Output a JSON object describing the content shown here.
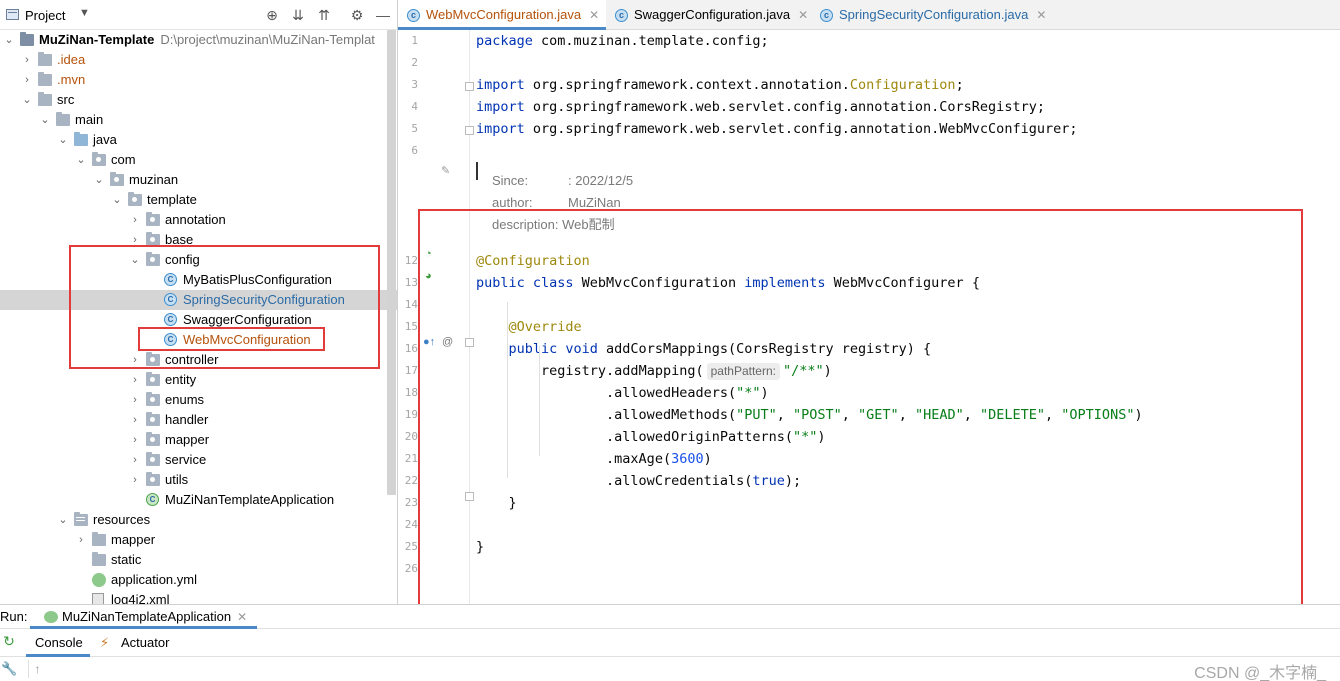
{
  "project_panel": {
    "title": "Project",
    "toolbar_icons": [
      "target-icon",
      "expand-all-icon",
      "collapse-all-icon",
      "gear-icon",
      "minimize-icon"
    ]
  },
  "tree": [
    {
      "label": "MuZiNan-Template",
      "note": "D:\\project\\muzinan\\MuZiNan-Templat",
      "depth": 0,
      "expanded": true,
      "icon": "module-folder"
    },
    {
      "label": ".idea",
      "depth": 1,
      "expanded": false,
      "icon": "folder"
    },
    {
      "label": ".mvn",
      "depth": 1,
      "expanded": false,
      "icon": "folder"
    },
    {
      "label": "src",
      "depth": 1,
      "expanded": true,
      "icon": "folder"
    },
    {
      "label": "main",
      "depth": 2,
      "expanded": true,
      "icon": "folder"
    },
    {
      "label": "java",
      "depth": 3,
      "expanded": true,
      "icon": "source-folder"
    },
    {
      "label": "com",
      "depth": 4,
      "expanded": true,
      "icon": "package"
    },
    {
      "label": "muzinan",
      "depth": 5,
      "expanded": true,
      "icon": "package"
    },
    {
      "label": "template",
      "depth": 6,
      "expanded": true,
      "icon": "package"
    },
    {
      "label": "annotation",
      "depth": 7,
      "expanded": false,
      "icon": "package"
    },
    {
      "label": "base",
      "depth": 7,
      "expanded": false,
      "icon": "package"
    },
    {
      "label": "config",
      "depth": 7,
      "expanded": true,
      "icon": "package"
    },
    {
      "label": "MyBatisPlusConfiguration",
      "depth": 8,
      "icon": "class"
    },
    {
      "label": "SpringSecurityConfiguration",
      "depth": 8,
      "icon": "class",
      "selected": true
    },
    {
      "label": "SwaggerConfiguration",
      "depth": 8,
      "icon": "class"
    },
    {
      "label": "WebMvcConfiguration",
      "depth": 8,
      "icon": "class",
      "modified": true
    },
    {
      "label": "controller",
      "depth": 7,
      "expanded": false,
      "icon": "package"
    },
    {
      "label": "entity",
      "depth": 7,
      "expanded": false,
      "icon": "package"
    },
    {
      "label": "enums",
      "depth": 7,
      "expanded": false,
      "icon": "package"
    },
    {
      "label": "handler",
      "depth": 7,
      "expanded": false,
      "icon": "package"
    },
    {
      "label": "mapper",
      "depth": 7,
      "expanded": false,
      "icon": "package"
    },
    {
      "label": "service",
      "depth": 7,
      "expanded": false,
      "icon": "package"
    },
    {
      "label": "utils",
      "depth": 7,
      "expanded": false,
      "icon": "package"
    },
    {
      "label": "MuZiNanTemplateApplication",
      "depth": 7,
      "icon": "app-class"
    },
    {
      "label": "resources",
      "depth": 3,
      "expanded": true,
      "icon": "resources-folder"
    },
    {
      "label": "mapper",
      "depth": 4,
      "expanded": false,
      "icon": "folder"
    },
    {
      "label": "static",
      "depth": 4,
      "icon": "folder"
    },
    {
      "label": "application.yml",
      "depth": 4,
      "icon": "yml-file"
    },
    {
      "label": "log4j2.xml",
      "depth": 4,
      "icon": "xml-file"
    }
  ],
  "editor": {
    "tabs": [
      {
        "label": "WebMvcConfiguration.java",
        "active": true,
        "color": "#b5520b"
      },
      {
        "label": "SwaggerConfiguration.java",
        "active": false,
        "color": "#000000"
      },
      {
        "label": "SpringSecurityConfiguration.java",
        "active": false,
        "color": "#2a6ba6"
      }
    ],
    "line_numbers": [
      "1",
      "2",
      "3",
      "4",
      "5",
      "6",
      "12",
      "13",
      "14",
      "15",
      "16",
      "17",
      "18",
      "19",
      "20",
      "21",
      "22",
      "23",
      "24",
      "25",
      "26"
    ],
    "code": {
      "l1": [
        "package",
        " com.muzinan.template.config;"
      ],
      "l3": [
        "import",
        " org.springframework.context.annotation.",
        "Configuration",
        ";"
      ],
      "l4": [
        "import",
        " org.springframework.web.servlet.config.annotation.CorsRegistry;"
      ],
      "l5": [
        "import",
        " org.springframework.web.servlet.config.annotation.WebMvcConfigurer;"
      ],
      "l12": [
        "@Configuration"
      ],
      "l13": [
        "public class",
        " WebMvcConfiguration ",
        "implements",
        " WebMvcConfigurer {"
      ],
      "l15": [
        "@Override"
      ],
      "l16": [
        "public void",
        " addCorsMappings(CorsRegistry registry) {"
      ],
      "l17": [
        "registry.addMapping(",
        "pathPattern:",
        "\"/**\"",
        ")"
      ],
      "l18": [
        ".allowedHeaders(",
        "\"*\"",
        ")"
      ],
      "l19": [
        ".allowedMethods(",
        "\"PUT\"",
        ", ",
        "\"POST\"",
        ", ",
        "\"GET\"",
        ", ",
        "\"HEAD\"",
        ", ",
        "\"DELETE\"",
        ", ",
        "\"OPTIONS\"",
        ")"
      ],
      "l20": [
        ".allowedOriginPatterns(",
        "\"*\"",
        ")"
      ],
      "l21": [
        ".maxAge(",
        "3600",
        ")"
      ],
      "l22": [
        ".allowCredentials(",
        "true",
        ");"
      ],
      "l23": [
        "}"
      ],
      "l25": [
        "}"
      ]
    },
    "doc": {
      "since_key": "Since:",
      "since_val": ": 2022/12/5",
      "author_key": "author:",
      "author_val": "MuZiNan",
      "desc": "description: Web配制"
    }
  },
  "run_panel": {
    "label": "Run:",
    "config_tab": "MuZiNanTemplateApplication",
    "sub_tabs": [
      "Console",
      "Actuator"
    ]
  },
  "watermark": "CSDN @_木字楠_",
  "colors": {
    "highlight_box": "#e23b3b",
    "active_tab_underline": "#4a88c7",
    "keyword": "#0033b3",
    "annotation": "#9e880d",
    "string": "#067d17"
  }
}
